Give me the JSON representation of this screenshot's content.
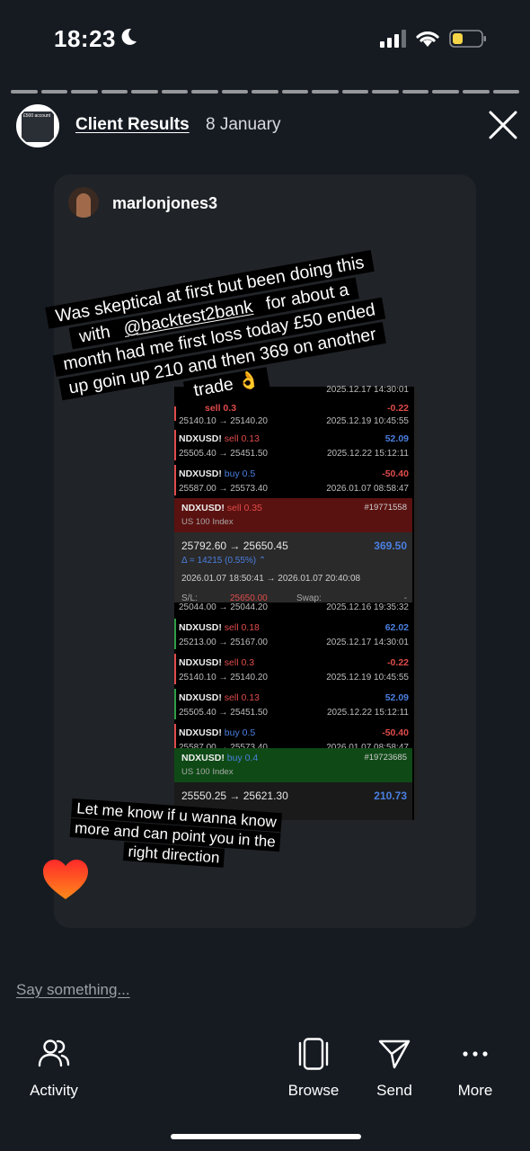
{
  "status_bar": {
    "time": "18:23"
  },
  "story": {
    "progress_segments": 17,
    "account_name": "Client Results",
    "date": "8 January",
    "avatar_text": "£500 account"
  },
  "post": {
    "username": "marlonjones3",
    "caption_top": {
      "before": "Was skeptical at first but been doing this with ",
      "mention": "@backtest2bank",
      "after": " for about a month had me first loss today £50 ended up goin up 210 and then 369 on another trade 👌"
    },
    "caption_bottom": "Let me know if u wanna know more and can point you in the right direction",
    "trades_top": [
      {
        "symbol": "",
        "side": "",
        "size": "sell 0.3",
        "pnl": "-0.22",
        "prices": "25140.10 → 25140.20",
        "date": "2025.12.19 10:45:55",
        "date_top": "2025.12.17 14:30:01",
        "dir": "sell"
      },
      {
        "symbol": "NDXUSD!",
        "size": "sell 0.13",
        "pnl": "52.09",
        "prices": "25505.40 → 25451.50",
        "date": "2025.12.22 15:12:11",
        "dir": "sell"
      },
      {
        "symbol": "NDXUSD!",
        "size": "buy 0.5",
        "pnl": "-50.40",
        "prices": "25587.00 → 25573.40",
        "date": "2026.01.07 08:58:47",
        "dir": "buy"
      }
    ],
    "detail_top": {
      "symbol": "NDXUSD!",
      "size": "sell 0.35",
      "id": "#19771558",
      "index": "US 100 Index",
      "prices": "25792.60 → 25650.45",
      "pnl": "369.50",
      "delta": "Δ = 14215 (0.55%) ⌃",
      "time": "2026.01.07 18:50:41 → 2026.01.07 20:40:08",
      "sl_label": "S/L:",
      "sl_value": "25650.00",
      "swap_label": "Swap:",
      "swap_value": "-"
    },
    "trades_bottom": [
      {
        "symbol": "",
        "size": "",
        "pnl": "",
        "prices": "25044.00 → 25044.20",
        "date": "2025.12.16 19:35:32",
        "dir": "sell"
      },
      {
        "symbol": "NDXUSD!",
        "size": "sell 0.18",
        "pnl": "62.02",
        "prices": "25213.00 → 25167.00",
        "date": "2025.12.17 14:30:01",
        "dir": "sell"
      },
      {
        "symbol": "NDXUSD!",
        "size": "sell 0.3",
        "pnl": "-0.22",
        "prices": "25140.10 → 25140.20",
        "date": "2025.12.19 10:45:55",
        "dir": "sell"
      },
      {
        "symbol": "NDXUSD!",
        "size": "sell 0.13",
        "pnl": "52.09",
        "prices": "25505.40 → 25451.50",
        "date": "2025.12.22 15:12:11",
        "dir": "sell"
      },
      {
        "symbol": "NDXUSD!",
        "size": "buy 0.5",
        "pnl": "-50.40",
        "prices": "25587.00 → 25573.40",
        "date": "2026.01.07 08:58:47",
        "dir": "buy"
      }
    ],
    "detail_bottom": {
      "symbol": "NDXUSD!",
      "size": "buy 0.4",
      "id": "#19723685",
      "index": "US 100 Index",
      "prices": "25550.25 → 25621.30",
      "pnl": "210.73"
    }
  },
  "reply": {
    "placeholder": "Say something..."
  },
  "actions": [
    {
      "label": "Activity",
      "icon": "people-icon"
    },
    {
      "label": "Browse",
      "icon": "browse-icon"
    },
    {
      "label": "Send",
      "icon": "send-icon"
    },
    {
      "label": "More",
      "icon": "more-icon"
    }
  ],
  "colors": {
    "background": "#161b22",
    "card": "#202327",
    "sell_header": "#5a1210",
    "buy_header": "#0f4a16",
    "positive": "#4a7fe0",
    "negative": "#e04b4b"
  }
}
